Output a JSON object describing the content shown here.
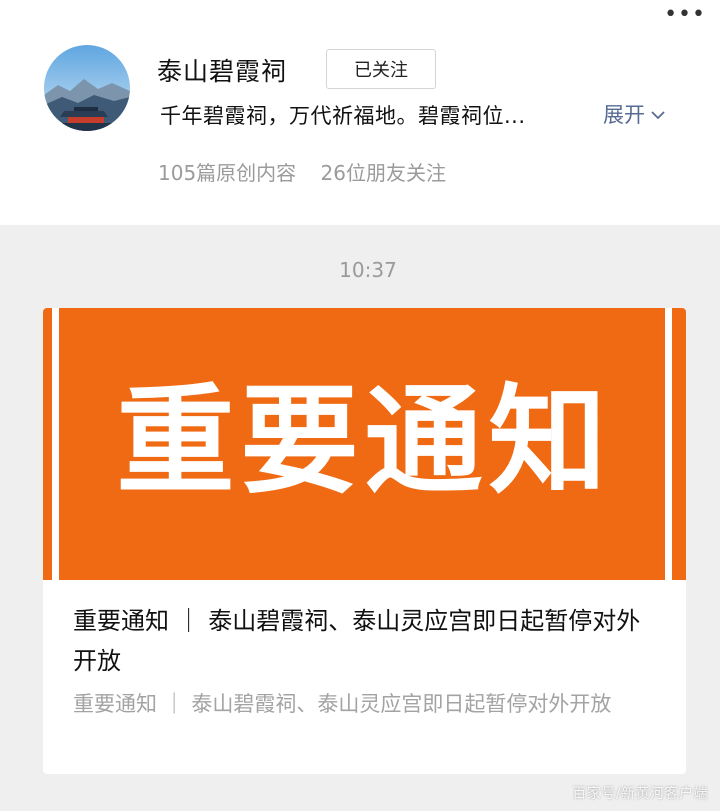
{
  "header": {
    "more_label": "•••",
    "account_name": "泰山碧霞祠",
    "follow_label": "已关注",
    "description": "千年碧霞祠，万代祈福地。碧霞祠位...",
    "expand_label": "展开",
    "stats": {
      "original_count": "105篇原创内容",
      "friends_following": "26位朋友关注"
    }
  },
  "feed": {
    "timestamp": "10:37",
    "article": {
      "cover_text": "重要通知",
      "cover_color": "#ef6a13",
      "title": "重要通知 ｜ 泰山碧霞祠、泰山灵应宫即日起暂停对外开放",
      "digest": "重要通知 ｜ 泰山碧霞祠、泰山灵应宫即日起暂停对外开放"
    }
  },
  "watermark": "百家号/新黄河客户端",
  "colors": {
    "link": "#576b95",
    "secondary_text": "#9b9b9b",
    "background": "#efefef"
  }
}
